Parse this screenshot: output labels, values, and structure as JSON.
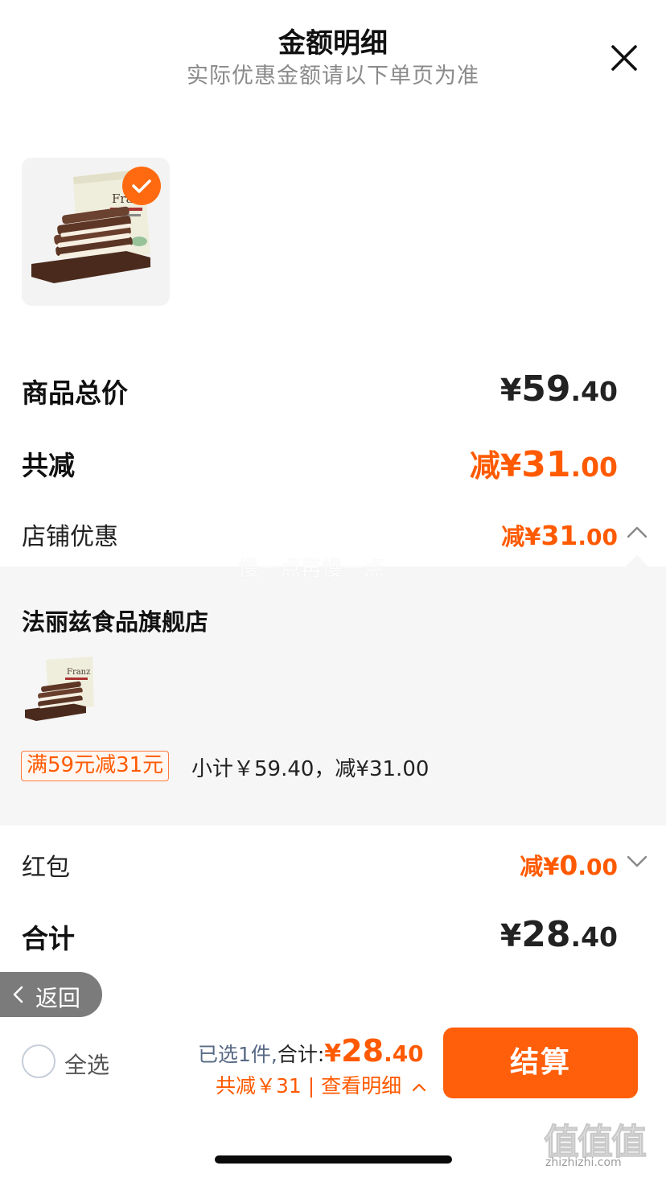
{
  "header": {
    "title": "金额明细",
    "subtitle": "实际优惠金额请以下单页为准"
  },
  "product": {
    "icon": "chocolate-wafer-product-image",
    "checked": true
  },
  "rows": {
    "goods_total": {
      "label": "商品总价",
      "yen": "¥",
      "int": "59",
      "dec": ".40"
    },
    "total_discount": {
      "label": "共减",
      "prefix": "减",
      "yen": "¥",
      "int": "31",
      "dec": ".00"
    },
    "store_discount": {
      "label": "店铺优惠",
      "prefix": "减",
      "yen": "¥",
      "int": "31",
      "dec": ".00"
    },
    "red_packet": {
      "label": "红包",
      "prefix": "减",
      "yen": "¥",
      "int": "0",
      "dec": ".00"
    },
    "grand_total": {
      "label": "合计",
      "yen": "¥",
      "int": "28",
      "dec": ".40"
    }
  },
  "store": {
    "watermark": "慢一点再慢一点",
    "name": "法丽兹食品旗舰店",
    "promo_tag": "满59元减31元",
    "subtotal": "小计￥59.40，减¥31.00"
  },
  "back": {
    "label": "返回"
  },
  "footer": {
    "select_all": "全选",
    "selected_text": "已选1件,",
    "total_label": "合计:",
    "pay_yen": "¥",
    "pay_int": "28",
    "pay_dec": ".40",
    "discount_detail": "共减￥31 | 查看明细",
    "checkout": "结算"
  },
  "watermark_brand": {
    "logo": "值值值",
    "url": "zhizhizhi.com"
  },
  "colors": {
    "accent": "#ff5e0a",
    "price_orange": "#ff5a00",
    "panel_bg": "#f6f6f6"
  }
}
